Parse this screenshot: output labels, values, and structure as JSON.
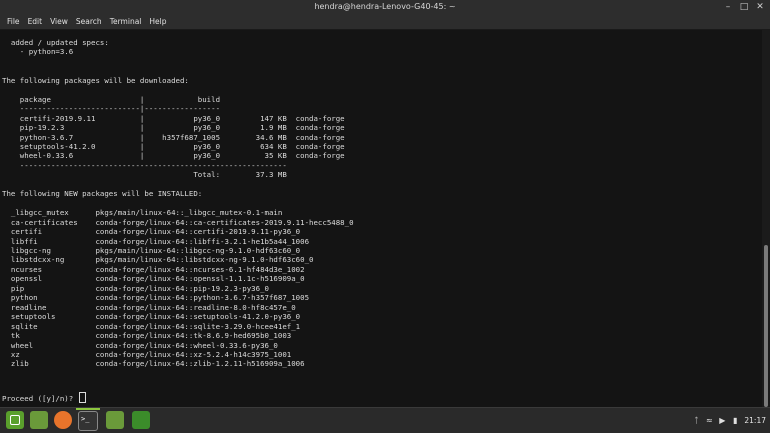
{
  "window": {
    "title": "hendra@hendra-Lenovo-G40-45: ~"
  },
  "menu": [
    "File",
    "Edit",
    "View",
    "Search",
    "Terminal",
    "Help"
  ],
  "terminal": {
    "lines": [
      "  added / updated specs:",
      "    - python=3.6",
      "",
      "",
      "The following packages will be downloaded:",
      "",
      "    package                    |            build",
      "    ---------------------------|-----------------",
      "    certifi-2019.9.11          |           py36_0         147 KB  conda-forge",
      "    pip-19.2.3                 |           py36_0         1.9 MB  conda-forge",
      "    python-3.6.7               |    h357f687_1005        34.6 MB  conda-forge",
      "    setuptools-41.2.0          |           py36_0         634 KB  conda-forge",
      "    wheel-0.33.6               |           py36_0          35 KB  conda-forge",
      "    ------------------------------------------------------------",
      "                                           Total:        37.3 MB",
      "",
      "The following NEW packages will be INSTALLED:",
      "",
      "  _libgcc_mutex      pkgs/main/linux-64::_libgcc_mutex-0.1-main",
      "  ca-certificates    conda-forge/linux-64::ca-certificates-2019.9.11-hecc5488_0",
      "  certifi            conda-forge/linux-64::certifi-2019.9.11-py36_0",
      "  libffi             conda-forge/linux-64::libffi-3.2.1-he1b5a44_1006",
      "  libgcc-ng          pkgs/main/linux-64::libgcc-ng-9.1.0-hdf63c60_0",
      "  libstdcxx-ng       pkgs/main/linux-64::libstdcxx-ng-9.1.0-hdf63c60_0",
      "  ncurses            conda-forge/linux-64::ncurses-6.1-hf484d3e_1002",
      "  openssl            conda-forge/linux-64::openssl-1.1.1c-h516909a_0",
      "  pip                conda-forge/linux-64::pip-19.2.3-py36_0",
      "  python             conda-forge/linux-64::python-3.6.7-h357f687_1005",
      "  readline           conda-forge/linux-64::readline-8.0-hf8c457e_0",
      "  setuptools         conda-forge/linux-64::setuptools-41.2.0-py36_0",
      "  sqlite             conda-forge/linux-64::sqlite-3.29.0-hcee41ef_1",
      "  tk                 conda-forge/linux-64::tk-8.6.9-hed695b0_1003",
      "  wheel              conda-forge/linux-64::wheel-0.33.6-py36_0",
      "  xz                 conda-forge/linux-64::xz-5.2.4-h14c3975_1001",
      "  zlib               conda-forge/linux-64::zlib-1.2.11-h516909a_1006"
    ],
    "prompt": "Proceed ([y]/n)? "
  },
  "taskbar": {
    "launchers": [
      "menu-icon",
      "files-icon",
      "firefox-icon",
      "terminal-icon",
      "files-icon",
      "mint-icon"
    ],
    "tray_icons": [
      "bluetooth-icon",
      "wifi-icon",
      "volume-icon",
      "battery-icon"
    ],
    "clock": "21:17"
  },
  "colors": {
    "terminal_bg": "#141414",
    "terminal_fg": "#dcdcdc",
    "titlebar_bg": "#2d2d2d",
    "accent_green": "#8dc63f"
  }
}
